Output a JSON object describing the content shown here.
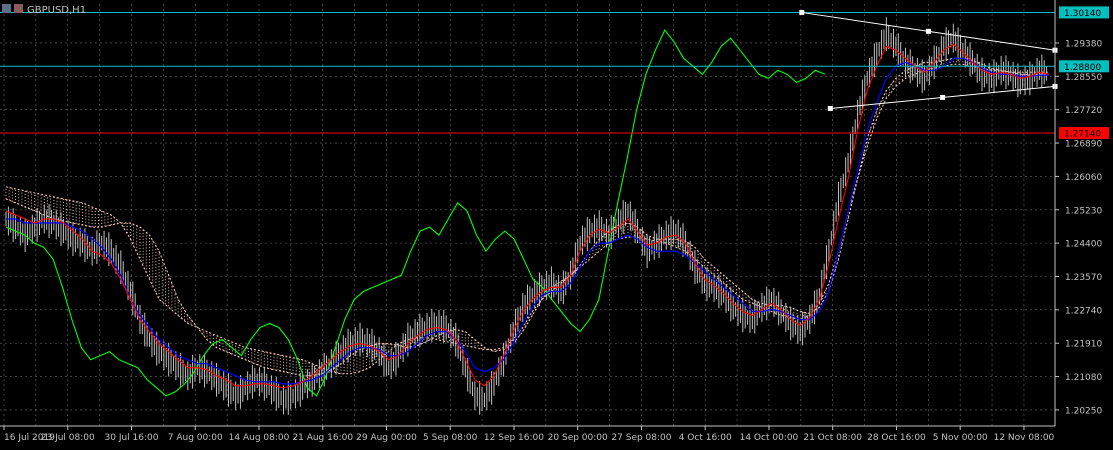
{
  "header": {
    "symbol_label": "GBPUSD,H1"
  },
  "colors": {
    "background": "#000000",
    "grid": "#c0c0c0",
    "price": "#c0c0c0",
    "tenkan": "#ff0000",
    "kijun": "#0000ff",
    "chikou": "#00ff00",
    "cloud": "#ffd2be",
    "hline_cyan": "#00c0c0",
    "hline_red": "#ff0000",
    "label_cyan_bg": "#00c0c0",
    "label_red_bg": "#ff0000",
    "trendline": "#ffffff"
  },
  "chart_data": {
    "type": "line",
    "symbol": "GBPUSD",
    "timeframe": "H1",
    "x_tick_labels": [
      "16 Jul 2019",
      "23 Jul 08:00",
      "30 Jul 16:00",
      "7 Aug 00:00",
      "14 Aug 08:00",
      "21 Aug 16:00",
      "29 Aug 00:00",
      "5 Sep 08:00",
      "12 Sep 16:00",
      "20 Sep 00:00",
      "27 Sep 08:00",
      "4 Oct 16:00",
      "14 Oct 00:00",
      "21 Oct 08:00",
      "28 Oct 16:00",
      "5 Nov 00:00",
      "12 Nov 08:00"
    ],
    "y_tick_labels": [
      "1.29380",
      "1.28550",
      "1.27720",
      "1.26890",
      "1.26060",
      "1.25230",
      "1.24400",
      "1.23570",
      "1.22740",
      "1.21910",
      "1.21080",
      "1.20250"
    ],
    "ylim": [
      1.1985,
      1.3035
    ],
    "price_labels": [
      {
        "value": "1.30140",
        "style": "cyan"
      },
      {
        "value": "1.28800",
        "style": "cyan"
      },
      {
        "value": "1.27140",
        "style": "red"
      }
    ],
    "horizontal_lines": [
      {
        "y": 1.3014,
        "color": "cyan"
      },
      {
        "y": 1.288,
        "color": "cyan"
      },
      {
        "y": 1.2714,
        "color": "red"
      }
    ],
    "grid": true,
    "series": [
      {
        "key": "price",
        "kind": "bars",
        "values": [
          1.25,
          1.248,
          1.246,
          1.248,
          1.25,
          1.249,
          1.247,
          1.245,
          1.244,
          1.242,
          1.244,
          1.242,
          1.238,
          1.232,
          1.225,
          1.22,
          1.217,
          1.215,
          1.213,
          1.211,
          1.213,
          1.212,
          1.21,
          1.208,
          1.206,
          1.208,
          1.21,
          1.209,
          1.207,
          1.205,
          1.206,
          1.208,
          1.21,
          1.212,
          1.214,
          1.217,
          1.219,
          1.22,
          1.219,
          1.217,
          1.213,
          1.216,
          1.22,
          1.222,
          1.223,
          1.224,
          1.223,
          1.22,
          1.213,
          1.206,
          1.205,
          1.209,
          1.215,
          1.222,
          1.228,
          1.231,
          1.233,
          1.234,
          1.232,
          1.236,
          1.244,
          1.247,
          1.248,
          1.246,
          1.249,
          1.252,
          1.247,
          1.242,
          1.244,
          1.246,
          1.247,
          1.244,
          1.238,
          1.234,
          1.233,
          1.231,
          1.228,
          1.226,
          1.225,
          1.228,
          1.23,
          1.227,
          1.224,
          1.222,
          1.225,
          1.231,
          1.242,
          1.255,
          1.264,
          1.276,
          1.285,
          1.291,
          1.296,
          1.293,
          1.289,
          1.287,
          1.285,
          1.289,
          1.293,
          1.295,
          1.292,
          1.289,
          1.286,
          1.285,
          1.287,
          1.286,
          1.284,
          1.285,
          1.287,
          1.286
        ]
      },
      {
        "key": "tenkan",
        "kind": "line",
        "values": [
          1.252,
          1.251,
          1.25,
          1.249,
          1.25,
          1.25,
          1.249,
          1.247,
          1.245,
          1.242,
          1.241,
          1.239,
          1.235,
          1.23,
          1.225,
          1.222,
          1.219,
          1.217,
          1.215,
          1.213,
          1.213,
          1.2125,
          1.211,
          1.21,
          1.2085,
          1.2085,
          1.209,
          1.209,
          1.2085,
          1.208,
          1.2085,
          1.2095,
          1.211,
          1.213,
          1.215,
          1.217,
          1.2185,
          1.219,
          1.2185,
          1.217,
          1.215,
          1.216,
          1.219,
          1.221,
          1.2225,
          1.223,
          1.2225,
          1.22,
          1.215,
          1.21,
          1.2085,
          1.211,
          1.216,
          1.222,
          1.227,
          1.23,
          1.232,
          1.233,
          1.233,
          1.236,
          1.242,
          1.246,
          1.2475,
          1.2465,
          1.248,
          1.25,
          1.247,
          1.2435,
          1.244,
          1.2455,
          1.246,
          1.244,
          1.239,
          1.235,
          1.2335,
          1.2315,
          1.229,
          1.227,
          1.226,
          1.2275,
          1.229,
          1.2275,
          1.225,
          1.2235,
          1.2255,
          1.23,
          1.239,
          1.25,
          1.26,
          1.272,
          1.282,
          1.288,
          1.293,
          1.292,
          1.29,
          1.288,
          1.2865,
          1.289,
          1.292,
          1.2935,
          1.2915,
          1.289,
          1.287,
          1.286,
          1.2865,
          1.286,
          1.285,
          1.2855,
          1.2865,
          1.286
        ]
      },
      {
        "key": "kijun",
        "kind": "line",
        "values": [
          1.25,
          1.25,
          1.249,
          1.249,
          1.249,
          1.249,
          1.249,
          1.248,
          1.247,
          1.245,
          1.243,
          1.24,
          1.236,
          1.23,
          1.226,
          1.223,
          1.22,
          1.218,
          1.216,
          1.215,
          1.214,
          1.214,
          1.213,
          1.212,
          1.211,
          1.21,
          1.2095,
          1.2095,
          1.2095,
          1.209,
          1.209,
          1.2095,
          1.21,
          1.211,
          1.213,
          1.215,
          1.217,
          1.218,
          1.218,
          1.2175,
          1.216,
          1.216,
          1.217,
          1.219,
          1.221,
          1.222,
          1.222,
          1.22,
          1.217,
          1.213,
          1.212,
          1.213,
          1.215,
          1.219,
          1.224,
          1.228,
          1.231,
          1.232,
          1.232,
          1.234,
          1.238,
          1.242,
          1.244,
          1.244,
          1.245,
          1.246,
          1.245,
          1.243,
          1.242,
          1.242,
          1.242,
          1.241,
          1.239,
          1.237,
          1.235,
          1.233,
          1.231,
          1.229,
          1.227,
          1.227,
          1.2275,
          1.227,
          1.226,
          1.225,
          1.225,
          1.227,
          1.232,
          1.242,
          1.252,
          1.262,
          1.272,
          1.279,
          1.285,
          1.288,
          1.289,
          1.288,
          1.287,
          1.287,
          1.288,
          1.29,
          1.29,
          1.289,
          1.2875,
          1.2865,
          1.286,
          1.286,
          1.2855,
          1.2855,
          1.2858,
          1.2858
        ]
      },
      {
        "key": "chikou",
        "kind": "line",
        "values": [
          1.248,
          1.247,
          1.246,
          1.244,
          1.243,
          1.24,
          1.233,
          1.225,
          1.218,
          1.215,
          1.216,
          1.217,
          1.215,
          1.214,
          1.213,
          1.21,
          1.208,
          1.206,
          1.207,
          1.209,
          1.212,
          1.216,
          1.219,
          1.22,
          1.218,
          1.216,
          1.22,
          1.223,
          1.224,
          1.223,
          1.22,
          1.215,
          1.208,
          1.206,
          1.211,
          1.218,
          1.225,
          1.23,
          1.232,
          1.233,
          1.234,
          1.235,
          1.236,
          1.242,
          1.247,
          1.248,
          1.246,
          1.25,
          1.254,
          1.252,
          1.246,
          1.242,
          1.245,
          1.247,
          1.245,
          1.24,
          1.235,
          1.233,
          1.23,
          1.227,
          1.224,
          1.222,
          1.225,
          1.23,
          1.242,
          1.254,
          1.265,
          1.277,
          1.286,
          1.292,
          1.297,
          1.294,
          1.29,
          1.288,
          1.286,
          1.289,
          1.293,
          1.295,
          1.292,
          1.289,
          1.286,
          1.285,
          1.287,
          1.286,
          1.284,
          1.285,
          1.287,
          1.286
        ]
      },
      {
        "key": "senkou_a",
        "kind": "cloud-edge",
        "values": [
          1.255,
          1.254,
          1.253,
          1.252,
          1.251,
          1.25,
          1.2495,
          1.249,
          1.2485,
          1.248,
          1.248,
          1.2485,
          1.249,
          1.249,
          1.248,
          1.246,
          1.242,
          1.236,
          1.23,
          1.226,
          1.223,
          1.22,
          1.218,
          1.217,
          1.216,
          1.215,
          1.214,
          1.213,
          1.2125,
          1.212,
          1.2115,
          1.211,
          1.211,
          1.2115,
          1.2125,
          1.214,
          1.216,
          1.2175,
          1.2185,
          1.219,
          1.219,
          1.2185,
          1.218,
          1.2185,
          1.2195,
          1.221,
          1.222,
          1.2225,
          1.222,
          1.22,
          1.218,
          1.217,
          1.2175,
          1.219,
          1.222,
          1.226,
          1.23,
          1.233,
          1.2345,
          1.236,
          1.2385,
          1.242,
          1.245,
          1.247,
          1.2485,
          1.249,
          1.248,
          1.246,
          1.245,
          1.245,
          1.245,
          1.2445,
          1.243,
          1.24,
          1.238,
          1.236,
          1.234,
          1.232,
          1.23,
          1.229,
          1.2285,
          1.2285,
          1.228,
          1.227,
          1.2265,
          1.228,
          1.232,
          1.24,
          1.25,
          1.26,
          1.27,
          1.277,
          1.282,
          1.285,
          1.287,
          1.288,
          1.289,
          1.289,
          1.2895,
          1.29,
          1.29,
          1.2895,
          1.2885,
          1.2875,
          1.287,
          1.2865,
          1.286,
          1.2858,
          1.286,
          1.286
        ]
      },
      {
        "key": "senkou_b",
        "kind": "cloud-edge",
        "values": [
          1.258,
          1.2575,
          1.257,
          1.2565,
          1.256,
          1.2555,
          1.255,
          1.2545,
          1.254,
          1.253,
          1.252,
          1.251,
          1.249,
          1.245,
          1.24,
          1.235,
          1.23,
          1.228,
          1.226,
          1.224,
          1.223,
          1.222,
          1.221,
          1.22,
          1.219,
          1.218,
          1.2175,
          1.217,
          1.2165,
          1.216,
          1.2155,
          1.215,
          1.214,
          1.213,
          1.212,
          1.2115,
          1.2115,
          1.212,
          1.213,
          1.215,
          1.217,
          1.219,
          1.22,
          1.2205,
          1.2205,
          1.22,
          1.2195,
          1.219,
          1.2185,
          1.218,
          1.2175,
          1.2175,
          1.218,
          1.22,
          1.223,
          1.227,
          1.23,
          1.232,
          1.234,
          1.236,
          1.238,
          1.24,
          1.242,
          1.244,
          1.245,
          1.2455,
          1.2455,
          1.245,
          1.2445,
          1.244,
          1.243,
          1.242,
          1.24,
          1.238,
          1.236,
          1.234,
          1.232,
          1.23,
          1.229,
          1.228,
          1.227,
          1.226,
          1.2255,
          1.225,
          1.226,
          1.229,
          1.234,
          1.242,
          1.252,
          1.26,
          1.268,
          1.275,
          1.28,
          1.283,
          1.285,
          1.286,
          1.287,
          1.2875,
          1.288,
          1.2885,
          1.2885,
          1.288,
          1.2875,
          1.287,
          1.2868,
          1.2866,
          1.2865,
          1.2865,
          1.2865,
          1.2865
        ]
      }
    ],
    "trendlines": [
      {
        "from": [
          0.76,
          1.3014
        ],
        "to": [
          1.0,
          1.292
        ]
      },
      {
        "from": [
          0.787,
          1.2775
        ],
        "to": [
          1.0,
          1.283
        ]
      }
    ]
  }
}
